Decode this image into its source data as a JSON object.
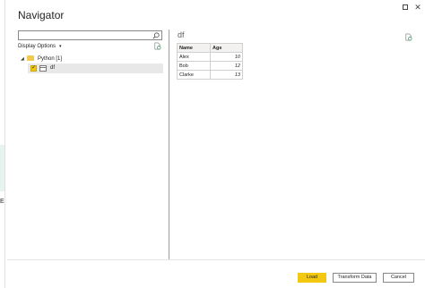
{
  "window": {
    "title": "Navigator",
    "side_marker": "E"
  },
  "search": {
    "value": "",
    "placeholder": "",
    "icon": "search-icon"
  },
  "display_options": {
    "label": "Display Options",
    "chevron": "▾"
  },
  "tree": {
    "root": {
      "label": "Python [1]",
      "expanded": true,
      "icon": "folder-icon"
    },
    "items": [
      {
        "label": "df",
        "checked": true,
        "icon": "table-icon"
      }
    ]
  },
  "preview": {
    "title": "df",
    "columns": [
      "Name",
      "Age"
    ],
    "rows": [
      {
        "name": "Alex",
        "age": "10"
      },
      {
        "name": "Bob",
        "age": "12"
      },
      {
        "name": "Clarke",
        "age": "13"
      }
    ]
  },
  "footer": {
    "load_label": "Load",
    "transform_label": "Transform Data",
    "cancel_label": "Cancel"
  },
  "colors": {
    "accent": "#F2C811",
    "folder": "#F2C94C",
    "selected_row": "#E8E8E8"
  }
}
